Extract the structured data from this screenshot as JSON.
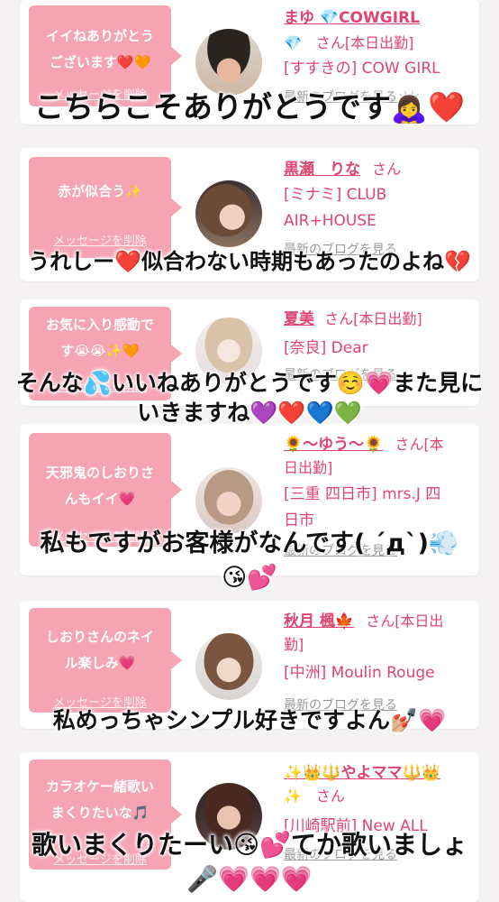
{
  "colors": {
    "accent": "#e0456f",
    "bubble": "#f6a3b2",
    "background": "#f4f2f2"
  },
  "cards": [
    {
      "message": "イイねありがとう\nございます❤️🧡",
      "delete_label": "メッセージを削除",
      "name": "まゆ 💎COWGIRL",
      "suffix": "💎　さん[本日出勤]",
      "shop": "[すすきの] COW GIRL",
      "blog": "最新のブログを見る",
      "overlay": "こちらこそありがとうです🙇‍♀️❤️"
    },
    {
      "message": "赤が似合う✨",
      "delete_label": "メッセージを削除",
      "name": "黒瀬　りな",
      "suffix": "さん",
      "shop": "[ミナミ] CLUB\nAIR+HOUSE",
      "blog": "最新のブログを見る",
      "overlay": "うれしー❤️似合わない時期もあったのよね💔"
    },
    {
      "message": "お気に入り感動で\nす😭😭✨🧡",
      "delete_label": "メッセージを削除",
      "name": "夏美",
      "suffix": "さん[本日出勤]",
      "shop": "[奈良] Dear",
      "blog": "最新のブログを見る",
      "overlay": "そんな💦いいねありがとうです☺️💗また見に\nいきますね💜❤️💙💚"
    },
    {
      "message": "天邪鬼のしおりさ\nんもイイ💗",
      "delete_label": "メッセージを削除",
      "name": "🌻〜ゆう〜🌻",
      "suffix": "さん[本\n日出勤]",
      "shop": "[三重 四日市] mrs.J 四\n日市",
      "blog": "最新のブログを見る",
      "overlay": "私もですがお客様がなんです( ´д`)💨\n😘💕"
    },
    {
      "message": "しおりさんのネイ\nル楽しみ💗",
      "delete_label": "メッセージを削除",
      "name": "秋月 楓🍁",
      "suffix": "さん[本日出\n勤]",
      "shop": "[中洲] Moulin Rouge",
      "blog": "最新のブログを見る",
      "overlay": "私めっちゃシンプル好きですよん💅🏼💗"
    },
    {
      "message": "カラオケー緒歌い\nまくりたいな🎵",
      "delete_label": "メッセージを削除",
      "name": "✨👑🔱やよママ🔱👑",
      "suffix": "✨　さん",
      "shop": "[川崎駅前] New ALL",
      "blog": "最新のブログを見る",
      "overlay": "歌いまくりたーい😘💕てか歌いましょ\n🎤💗💗💗"
    }
  ]
}
